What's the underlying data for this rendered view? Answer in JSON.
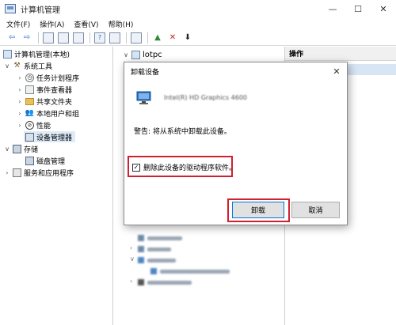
{
  "window": {
    "title": "计算机管理",
    "minimize": "—",
    "maximize": "☐",
    "close": "✕"
  },
  "menu": [
    "文件(F)",
    "操作(A)",
    "查看(V)",
    "帮助(H)"
  ],
  "toolbar": {
    "back": "⇦",
    "forward": "⇨",
    "remove": "✕",
    "download": "⬇"
  },
  "tree": {
    "root": "计算机管理(本地)",
    "system_tools": "系统工具",
    "task_scheduler": "任务计划程序",
    "event_viewer": "事件查看器",
    "shared_folders": "共享文件夹",
    "local_users": "本地用户和组",
    "performance": "性能",
    "device_manager": "设备管理器",
    "storage": "存储",
    "disk_management": "磁盘管理",
    "services_apps": "服务和应用程序"
  },
  "middle": {
    "root": "lotpc"
  },
  "actions": {
    "header": "操作"
  },
  "dialog": {
    "title": "卸载设备",
    "close": "✕",
    "device_name": "Intel(R) HD Graphics 4600",
    "warning": "警告: 将从系统中卸载此设备。",
    "checkbox_label": "删除此设备的驱动程序软件。",
    "checkbox_checked": true,
    "uninstall_button": "卸载",
    "cancel_button": "取消"
  },
  "colors": {
    "highlight": "#d02030",
    "accent": "#0078d7"
  }
}
